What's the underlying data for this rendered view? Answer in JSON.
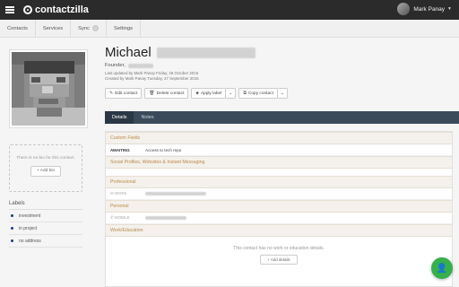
{
  "app": {
    "name": "contactzilla"
  },
  "user": {
    "name": "Mark Panay"
  },
  "nav": {
    "items": [
      {
        "label": "Contacts"
      },
      {
        "label": "Services"
      },
      {
        "label": "Sync",
        "badge": "0"
      },
      {
        "label": "Settings"
      }
    ]
  },
  "contact": {
    "first_name": "Michael",
    "title_prefix": "Founder,",
    "last_updated": "Last updated by Mark Panay Friday, 28 October 2016",
    "created": "Created by Mark Panay Tuesday, 27 September 2016"
  },
  "actions": {
    "edit": "Edit contact",
    "delete": "Delete contact",
    "apply_label": "Apply label",
    "copy": "Copy contact"
  },
  "tabs": [
    {
      "label": "Details"
    },
    {
      "label": "Notes"
    }
  ],
  "bio": {
    "empty_text": "There is no bio for this contact.",
    "add_label": "Add bio"
  },
  "labels": {
    "title": "Labels",
    "items": [
      {
        "label": "investment"
      },
      {
        "label": "in project"
      },
      {
        "label": "no address"
      }
    ]
  },
  "sections": {
    "custom_fields": "Custom Fields",
    "custom_key": "AWAITING",
    "custom_value": "Access to tech repo",
    "social": "Social Profiles, Websites & Instant Messaging",
    "professional": "Professional",
    "work_key": "WORK",
    "personal": "Personal",
    "mobile_key": "MOBILE",
    "work_education": "Work/Education",
    "no_work_text": "This contact has no work or education details.",
    "add_details": "Add details"
  },
  "colors": {
    "accent": "#35b04a",
    "topbar": "#2b2b2b",
    "section_text": "#b98a4a",
    "tab_bar": "#3a4a5a"
  }
}
